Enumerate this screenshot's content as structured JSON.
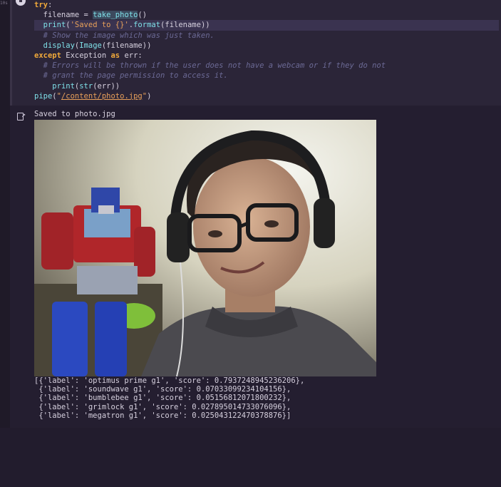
{
  "cell": {
    "exec_count": "10s",
    "code_lines": [
      {
        "tokens": [
          {
            "t": "try",
            "c": "kw"
          },
          {
            "t": ":",
            "c": "plain"
          }
        ]
      },
      {
        "tokens": [
          {
            "t": "  filename = ",
            "c": "plain"
          },
          {
            "t": "take_photo",
            "c": "fn hl-fn"
          },
          {
            "t": "()",
            "c": "plain"
          }
        ]
      },
      {
        "hl": true,
        "tokens": [
          {
            "t": "  ",
            "c": "plain"
          },
          {
            "t": "print",
            "c": "fn"
          },
          {
            "t": "(",
            "c": "plain"
          },
          {
            "t": "'Saved to {}'",
            "c": "str"
          },
          {
            "t": ".",
            "c": "plain"
          },
          {
            "t": "format",
            "c": "fn"
          },
          {
            "t": "(filename))",
            "c": "plain"
          }
        ]
      },
      {
        "tokens": [
          {
            "t": "  # Show the image which was just taken.",
            "c": "cm"
          }
        ]
      },
      {
        "tokens": [
          {
            "t": "  ",
            "c": "plain"
          },
          {
            "t": "display",
            "c": "fn"
          },
          {
            "t": "(",
            "c": "plain"
          },
          {
            "t": "Image",
            "c": "fn"
          },
          {
            "t": "(filename))",
            "c": "plain"
          }
        ]
      },
      {
        "tokens": [
          {
            "t": "except",
            "c": "kw"
          },
          {
            "t": " Exception ",
            "c": "plain"
          },
          {
            "t": "as",
            "c": "kw"
          },
          {
            "t": " err:",
            "c": "plain"
          }
        ]
      },
      {
        "tokens": [
          {
            "t": "  # Errors will be thrown if the user does not have a webcam or if they do not",
            "c": "cm"
          }
        ]
      },
      {
        "tokens": [
          {
            "t": "  # grant the page permission to access it.",
            "c": "cm"
          }
        ]
      },
      {
        "tokens": [
          {
            "t": "    ",
            "c": "plain"
          },
          {
            "t": "print",
            "c": "fn"
          },
          {
            "t": "(",
            "c": "plain"
          },
          {
            "t": "str",
            "c": "fn"
          },
          {
            "t": "(err))",
            "c": "plain"
          }
        ]
      },
      {
        "tokens": [
          {
            "t": "pipe",
            "c": "fn"
          },
          {
            "t": "(",
            "c": "plain"
          },
          {
            "t": "\"",
            "c": "str"
          },
          {
            "t": "/content/photo.jpg",
            "c": "path"
          },
          {
            "t": "\"",
            "c": "str"
          },
          {
            "t": ")",
            "c": "plain"
          }
        ]
      }
    ]
  },
  "output": {
    "saved_text": "Saved to photo.jpg",
    "results": [
      "[{'label': 'optimus prime g1', 'score': 0.7937248945236206},",
      " {'label': 'soundwave g1', 'score': 0.07033099234104156},",
      " {'label': 'bumblebee g1', 'score': 0.05156812071800232},",
      " {'label': 'grimlock g1', 'score': 0.027895014733076096},",
      " {'label': 'megatron g1', 'score': 0.025043122470378876}]"
    ]
  },
  "icons": {
    "run": "run-cell-icon",
    "output": "output-redirect-icon"
  }
}
